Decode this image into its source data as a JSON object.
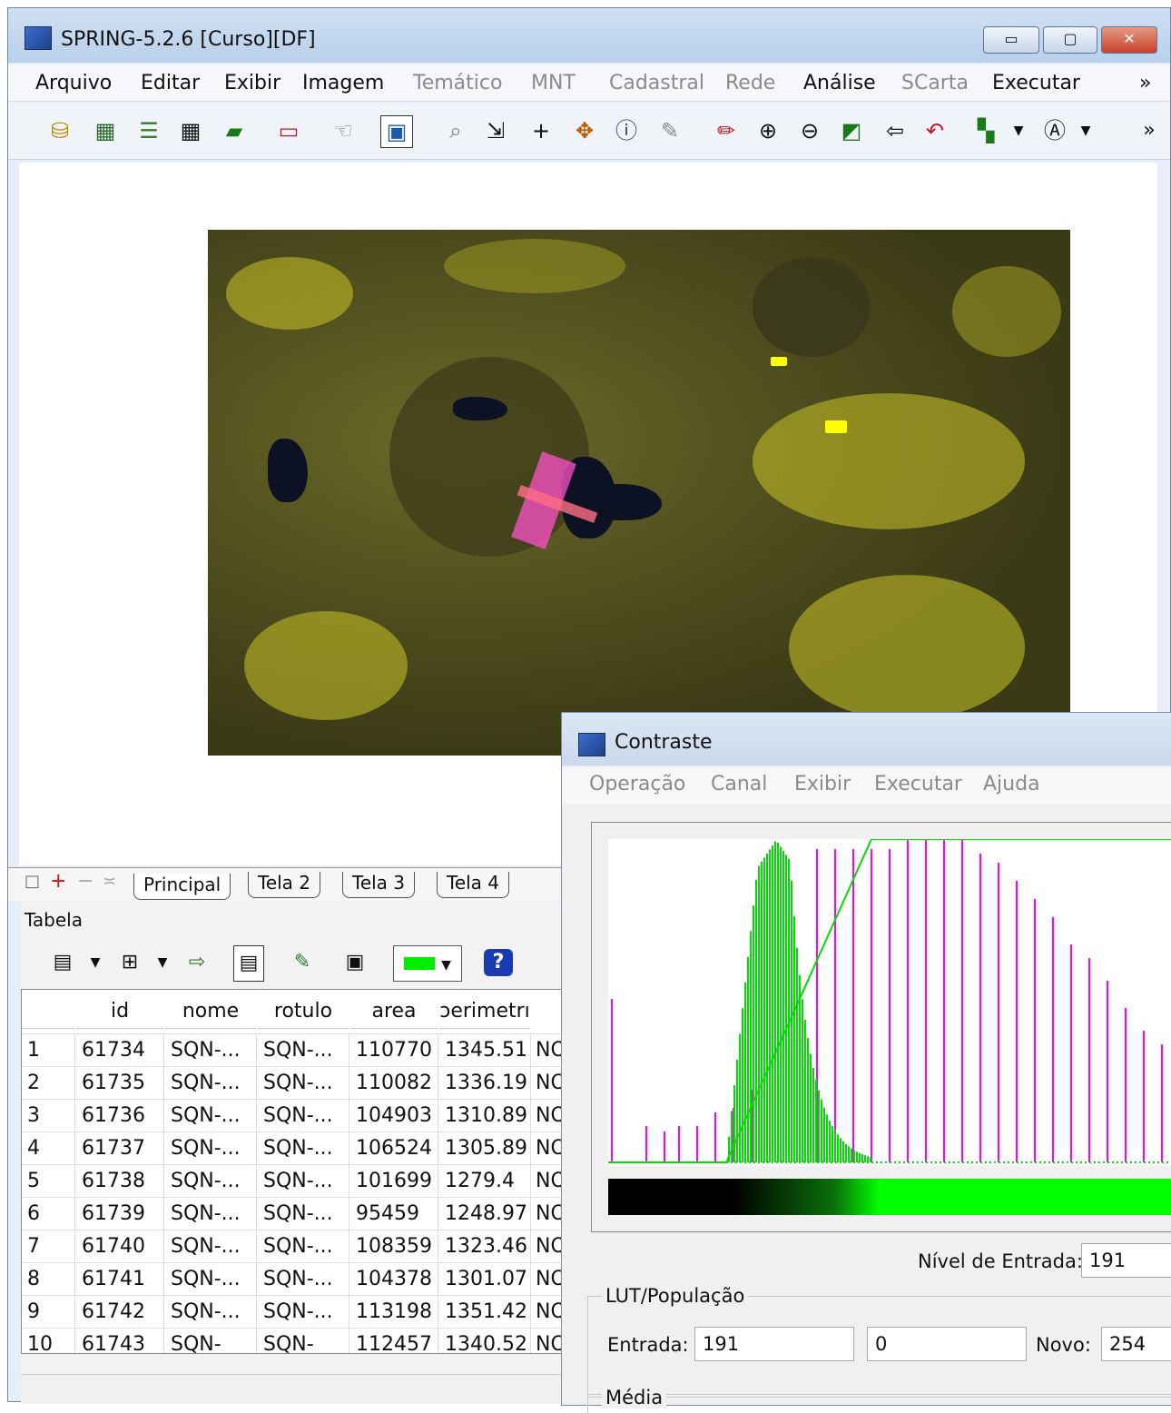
{
  "app": {
    "title": "SPRING-5.2.6 [Curso][DF]",
    "minimize": "▭",
    "maximize": "▢",
    "close": "✕"
  },
  "menu": [
    "Arquivo",
    "Editar",
    "Exibir",
    "Imagem",
    "Temático",
    "MNT",
    "Cadastral",
    "Rede",
    "Análise",
    "SCarta",
    "Executar",
    "»"
  ],
  "toolbar": {
    "overflow": "»"
  },
  "tabs": {
    "controls": [
      "□",
      "+",
      "−",
      "≍"
    ],
    "items": [
      "Principal",
      "Tela 2",
      "Tela 3",
      "Tela 4"
    ]
  },
  "tabela": {
    "title": "Tabela",
    "columns": [
      "",
      "id",
      "nome",
      "rotulo",
      "area",
      "perimetro"
    ],
    "header_display": [
      "",
      "id",
      "nome",
      "rotulo",
      "area",
      "ɔerimetrı"
    ],
    "rows": [
      [
        "1",
        "61734",
        "SQN-...",
        "SQN-...",
        "110770",
        "1345.51",
        "NO"
      ],
      [
        "2",
        "61735",
        "SQN-...",
        "SQN-...",
        "110082",
        "1336.19",
        "NO"
      ],
      [
        "3",
        "61736",
        "SQN-...",
        "SQN-...",
        "104903",
        "1310.89",
        "NO"
      ],
      [
        "4",
        "61737",
        "SQN-...",
        "SQN-...",
        "106524",
        "1305.89",
        "NO"
      ],
      [
        "5",
        "61738",
        "SQN-...",
        "SQN-...",
        "101699",
        "1279.4",
        "NO"
      ],
      [
        "6",
        "61739",
        "SQN-...",
        "SQN-...",
        "95459",
        "1248.97",
        "NO"
      ],
      [
        "7",
        "61740",
        "SQN-...",
        "SQN-...",
        "108359",
        "1323.46",
        "NO"
      ],
      [
        "8",
        "61741",
        "SQN-...",
        "SQN-...",
        "104378",
        "1301.07",
        "NO"
      ],
      [
        "9",
        "61742",
        "SQN-...",
        "SQN-...",
        "113198",
        "1351.42",
        "NO"
      ],
      [
        "10",
        "61743",
        "SQN-",
        "SQN-",
        "112457",
        "1340.52",
        "NO"
      ]
    ]
  },
  "contraste": {
    "title": "Contraste",
    "menu": [
      "Operação",
      "Canal",
      "Exibir",
      "Executar",
      "Ajuda"
    ],
    "nivel_label": "Nível de Entrada:",
    "nivel_value": "191",
    "lut_group": "LUT/População",
    "entrada_label": "Entrada:",
    "entrada_value": "191",
    "populacao_value": "0",
    "novo_label": "Novo:",
    "novo_value": "254",
    "media_group": "Média",
    "colors": {
      "histogram": "#00dd00",
      "lut": "#00dd00",
      "bars": "#ff00ff"
    }
  }
}
